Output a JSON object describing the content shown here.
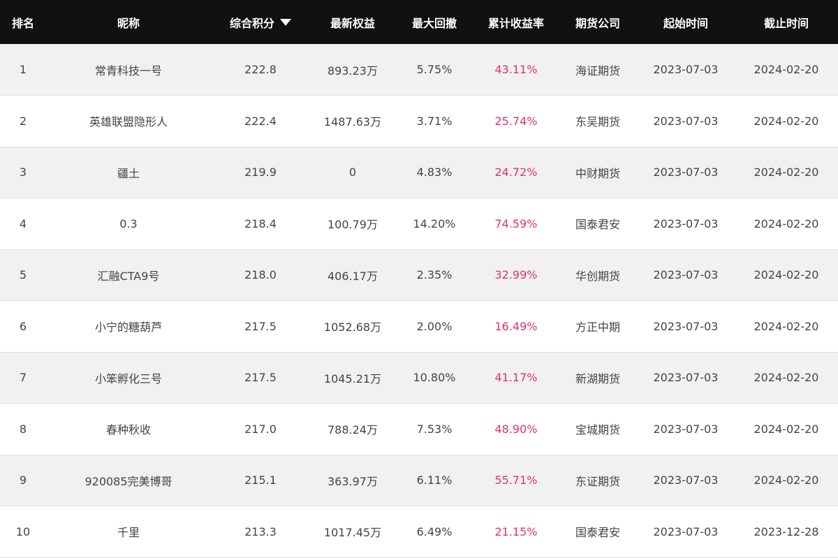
{
  "table": {
    "headers": {
      "rank": "排名",
      "nickname": "昵称",
      "score": "综合积分",
      "equity": "最新权益",
      "drawdown": "最大回撤",
      "return": "累计收益率",
      "firm": "期货公司",
      "start": "起始时间",
      "end": "截止时间"
    },
    "sort_icon": "caret-down-icon",
    "rows": [
      {
        "rank": "1",
        "nickname": "常青科技一号",
        "score": "222.8",
        "equity": "893.23万",
        "drawdown": "5.75%",
        "return": "43.11%",
        "firm": "海证期货",
        "start": "2023-07-03",
        "end": "2024-02-20"
      },
      {
        "rank": "2",
        "nickname": "英雄联盟隐形人",
        "score": "222.4",
        "equity": "1487.63万",
        "drawdown": "3.71%",
        "return": "25.74%",
        "firm": "东吴期货",
        "start": "2023-07-03",
        "end": "2024-02-20"
      },
      {
        "rank": "3",
        "nickname": "疆土",
        "score": "219.9",
        "equity": "0",
        "drawdown": "4.83%",
        "return": "24.72%",
        "firm": "中财期货",
        "start": "2023-07-03",
        "end": "2024-02-20"
      },
      {
        "rank": "4",
        "nickname": "0.3",
        "score": "218.4",
        "equity": "100.79万",
        "drawdown": "14.20%",
        "return": "74.59%",
        "firm": "国泰君安",
        "start": "2023-07-03",
        "end": "2024-02-20"
      },
      {
        "rank": "5",
        "nickname": "汇融CTA9号",
        "score": "218.0",
        "equity": "406.17万",
        "drawdown": "2.35%",
        "return": "32.99%",
        "firm": "华创期货",
        "start": "2023-07-03",
        "end": "2024-02-20"
      },
      {
        "rank": "6",
        "nickname": "小宁的糖葫芦",
        "score": "217.5",
        "equity": "1052.68万",
        "drawdown": "2.00%",
        "return": "16.49%",
        "firm": "方正中期",
        "start": "2023-07-03",
        "end": "2024-02-20"
      },
      {
        "rank": "7",
        "nickname": "小笨孵化三号",
        "score": "217.5",
        "equity": "1045.21万",
        "drawdown": "10.80%",
        "return": "41.17%",
        "firm": "新湖期货",
        "start": "2023-07-03",
        "end": "2024-02-20"
      },
      {
        "rank": "8",
        "nickname": "春种秋收",
        "score": "217.0",
        "equity": "788.24万",
        "drawdown": "7.53%",
        "return": "48.90%",
        "firm": "宝城期货",
        "start": "2023-07-03",
        "end": "2024-02-20"
      },
      {
        "rank": "9",
        "nickname": "920085完美博哥",
        "score": "215.1",
        "equity": "363.97万",
        "drawdown": "6.11%",
        "return": "55.71%",
        "firm": "东证期货",
        "start": "2023-07-03",
        "end": "2024-02-20"
      },
      {
        "rank": "10",
        "nickname": "千里",
        "score": "213.3",
        "equity": "1017.45万",
        "drawdown": "6.49%",
        "return": "21.15%",
        "firm": "国泰君安",
        "start": "2023-07-03",
        "end": "2023-12-28"
      }
    ]
  },
  "colors": {
    "header_bg": "#111111",
    "return_accent": "#e5306f",
    "row_alt_bg": "#f1f1f1"
  }
}
